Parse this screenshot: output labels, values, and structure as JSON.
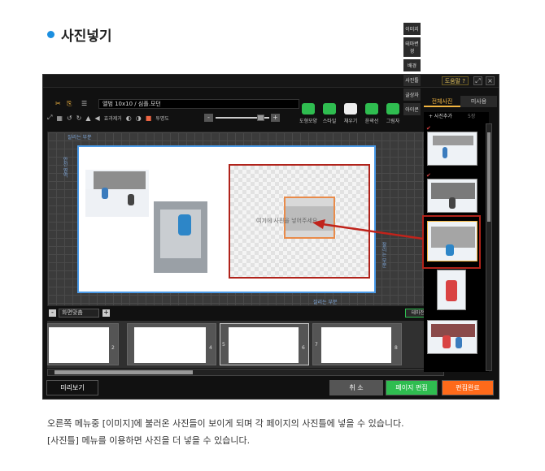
{
  "heading": "사진넣기",
  "window": {
    "help_label": "도움말 ?",
    "book_title": "앨범 10x10 / 심플.모던",
    "small_tool_labels": [
      "효과제거",
      "투명도"
    ],
    "tools": [
      {
        "label": "도형모양",
        "icon": "shape-icon"
      },
      {
        "label": "스타일",
        "icon": "style-icon"
      },
      {
        "label": "채우기",
        "icon": "fill-icon"
      },
      {
        "label": "윤곽선",
        "icon": "outline-icon"
      },
      {
        "label": "그림자",
        "icon": "shadow-icon"
      }
    ],
    "canvas": {
      "guide_top": "잘리는 부분",
      "guide_left": "안전 영역",
      "guide_right": "잘리는 부분",
      "guide_bottom": "잘리는 부분",
      "drop_hint": "여기에 사진을 넣어주세요"
    },
    "zoom_value": "화면맞춤",
    "theme_button": "테마전체변경",
    "pages": [
      "2",
      "4",
      "5",
      "6",
      "7",
      "8"
    ],
    "bottom_buttons": {
      "preview": "미리보기",
      "cancel": "취 소",
      "page_edit": "페이지 편집",
      "finish": "편집완료"
    },
    "side_tabs": [
      "이미지",
      "테마변경",
      "배경",
      "사진틀",
      "글상자",
      "아이콘"
    ],
    "panel_tabs": [
      "전체사진",
      "미사용"
    ],
    "add_photo_label": "+ 사진추가",
    "photo_count": "5장"
  },
  "description": [
    "오른쪽 메뉴중 [이미지]에 불러온 사진들이 보이게 되며 각 페이지의 사진틀에 넣을 수 있습니다.",
    "[사진틀] 메뉴를 이용하면 사진을 더 넣을 수 있습니다."
  ],
  "colors": {
    "accent_blue": "#1c8fe0",
    "highlight_red": "#b0231b",
    "green_button": "#2fbd50",
    "orange_button": "#ff6a1a"
  }
}
